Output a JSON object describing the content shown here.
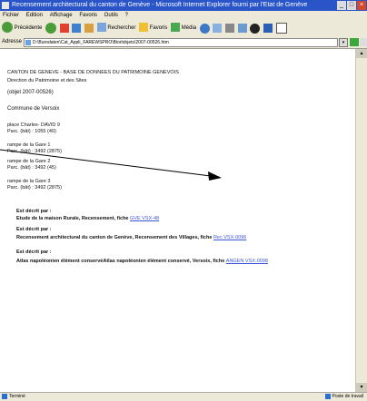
{
  "window": {
    "title": "Recensement architectural du canton de Genève - Microsoft Internet Explorer fourni par l'Etat de Genève"
  },
  "menu": [
    "Fichier",
    "Edition",
    "Affichage",
    "Favoris",
    "Outils",
    "?"
  ],
  "toolbar": {
    "back": "Précédente",
    "search": "Rechercher",
    "favorites": "Favoris",
    "media": "Média"
  },
  "address": {
    "label": "Adresse",
    "url": "D:\\Burodaten\\Cat_Appli_FAREWSPRO\\Biorlobjets\\2007-00526.htm"
  },
  "page": {
    "line1": "CANTON DE GENEVE - BASE DE DONNEES DU PATRIMOINE GENEVOIS",
    "line2": "Direction du Patrimoine et des Sites",
    "objet": "(objet 2007-00526)",
    "commune": "Commune de Versoix",
    "addresses": [
      {
        "street": "place Charles- DAVID 9",
        "parc": "Parc. (bât) :  1055  (40)"
      },
      {
        "street": "rampe de la Gare 1",
        "parc": "Parc. (bât) :  3492  (2875)"
      },
      {
        "street": "rampe de la Gare 2",
        "parc": "Parc. (bât) :  3492  (45)"
      },
      {
        "street": "rampe de la Gare 3",
        "parc": "Parc. (bât) :  3492  (2875)"
      }
    ],
    "described": [
      {
        "heading": "Est décrit par :",
        "text": "Etude de la maison Rurale, Recensement, fiche",
        "link": "GVE VSX-48"
      },
      {
        "heading": "Est décrit par :",
        "text": "Recensement architectural du canton de Genève, Recensement des Villages, fiche",
        "link": "Rec VSX-0096"
      },
      {
        "heading": "Est décrit par :",
        "text": "Atlas napoléonien élément conservéAtlas napoléonien élément conservé, Versoix, fiche",
        "link": "ANGEN VSX-0098"
      }
    ]
  },
  "status": {
    "left": "Terminé",
    "right": "Poste de travail"
  }
}
